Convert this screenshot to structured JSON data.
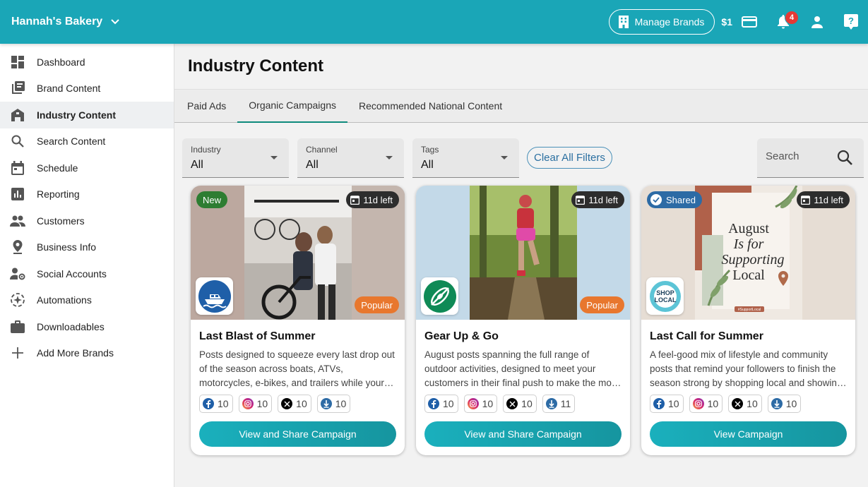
{
  "header": {
    "brand_name": "Hannah's Bakery",
    "manage_brands_label": "Manage Brands",
    "credit": "$1",
    "notification_count": "4",
    "colors": {
      "primary": "#1aa6b7"
    }
  },
  "sidebar": {
    "items": [
      {
        "label": "Dashboard",
        "icon": "dashboard-icon"
      },
      {
        "label": "Brand Content",
        "icon": "library-icon"
      },
      {
        "label": "Industry Content",
        "icon": "store-icon",
        "active": true
      },
      {
        "label": "Search Content",
        "icon": "search-icon"
      },
      {
        "label": "Schedule",
        "icon": "calendar-icon"
      },
      {
        "label": "Reporting",
        "icon": "chart-icon"
      },
      {
        "label": "Customers",
        "icon": "people-icon"
      },
      {
        "label": "Business Info",
        "icon": "location-pin-icon"
      },
      {
        "label": "Social Accounts",
        "icon": "user-settings-icon"
      },
      {
        "label": "Automations",
        "icon": "automation-icon"
      },
      {
        "label": "Downloadables",
        "icon": "briefcase-icon"
      },
      {
        "label": "Add More Brands",
        "icon": "plus-icon"
      }
    ]
  },
  "main": {
    "title": "Industry Content",
    "tabs": [
      {
        "label": "Paid Ads"
      },
      {
        "label": "Organic Campaigns",
        "active": true
      },
      {
        "label": "Recommended National Content"
      }
    ],
    "filters": {
      "industry": {
        "label": "Industry",
        "value": "All"
      },
      "channel": {
        "label": "Channel",
        "value": "All"
      },
      "tags": {
        "label": "Tags",
        "value": "All"
      },
      "clear_label": "Clear All Filters",
      "search_placeholder": "Search"
    },
    "cards": [
      {
        "title": "Last Blast of Summer",
        "description": "Posts designed to squeeze every last drop out of the season across boats, ATVs, motorcycles, e-bikes, and trailers while your customers still have time to enjoy them.",
        "badge": "New",
        "time_left": "11d left",
        "popular": "Popular",
        "stats": {
          "facebook": "10",
          "instagram": "10",
          "x": "10",
          "download": "10"
        },
        "cta": "View and Share Campaign"
      },
      {
        "title": "Gear Up & Go",
        "description": "August posts spanning the full range of outdoor activities, designed to meet your customers in their final push to make the most of summer.",
        "time_left": "11d left",
        "popular": "Popular",
        "stats": {
          "facebook": "10",
          "instagram": "10",
          "x": "10",
          "download": "11"
        },
        "cta": "View and Share Campaign"
      },
      {
        "title": "Last Call for Summer",
        "description": "A feel-good mix of lifestyle and community posts that remind your followers to finish the season strong by shopping local and showing up for their neighbors.",
        "badge": "Shared",
        "time_left": "11d left",
        "art_text": [
          "August",
          "Is for",
          "Supporting",
          "Local"
        ],
        "art_small": "#SupportLocal",
        "logo_text": [
          "SHOP",
          "LOCAL"
        ],
        "stats": {
          "facebook": "10",
          "instagram": "10",
          "x": "10",
          "download": "10"
        },
        "cta": "View Campaign"
      }
    ]
  }
}
